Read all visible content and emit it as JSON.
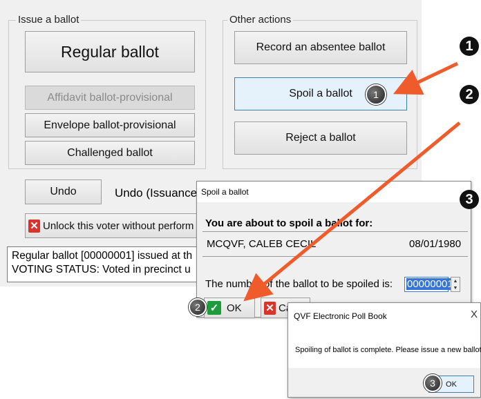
{
  "main": {
    "issue_group": {
      "legend": "Issue a ballot",
      "regular": "Regular ballot",
      "affidavit": "Affidavit ballot-provisional",
      "envelope": "Envelope ballot-provisional",
      "challenged": "Challenged ballot"
    },
    "other_group": {
      "legend": "Other actions",
      "absentee": "Record an absentee ballot",
      "spoil": "Spoil a ballot",
      "reject": "Reject a ballot"
    },
    "undo_button": "Undo",
    "undo_label": "Undo (Issuance",
    "unlock_button": "Unlock this voter without perform",
    "status_lines": [
      "Regular ballot [00000001] issued at th",
      "VOTING STATUS: Voted in precinct u"
    ]
  },
  "spoil_dialog": {
    "title": "Spoil a ballot",
    "heading": "You are about to spoil a ballot for:",
    "voter_name": "MCQVF, CALEB CECIL",
    "voter_dob": "08/01/1980",
    "number_label": "The number of the ballot to be spoiled is:",
    "ballot_number": "00000001",
    "ok_label": "OK",
    "cancel_label": "Ca"
  },
  "message_box": {
    "title": "QVF Electronic Poll Book",
    "text": "Spoiling of ballot is complete. Please issue a new ballot.",
    "ok_label": "OK",
    "close_glyph": "X"
  },
  "callouts": {
    "step1": "1",
    "step2": "2",
    "step3": "3",
    "marker1": "1",
    "marker2": "2",
    "marker3": "3"
  },
  "colors": {
    "arrow": "#ef5b2b",
    "accent_blue": "#3475d6",
    "ok_green": "#1e9c3b",
    "cancel_red": "#d9342b"
  }
}
